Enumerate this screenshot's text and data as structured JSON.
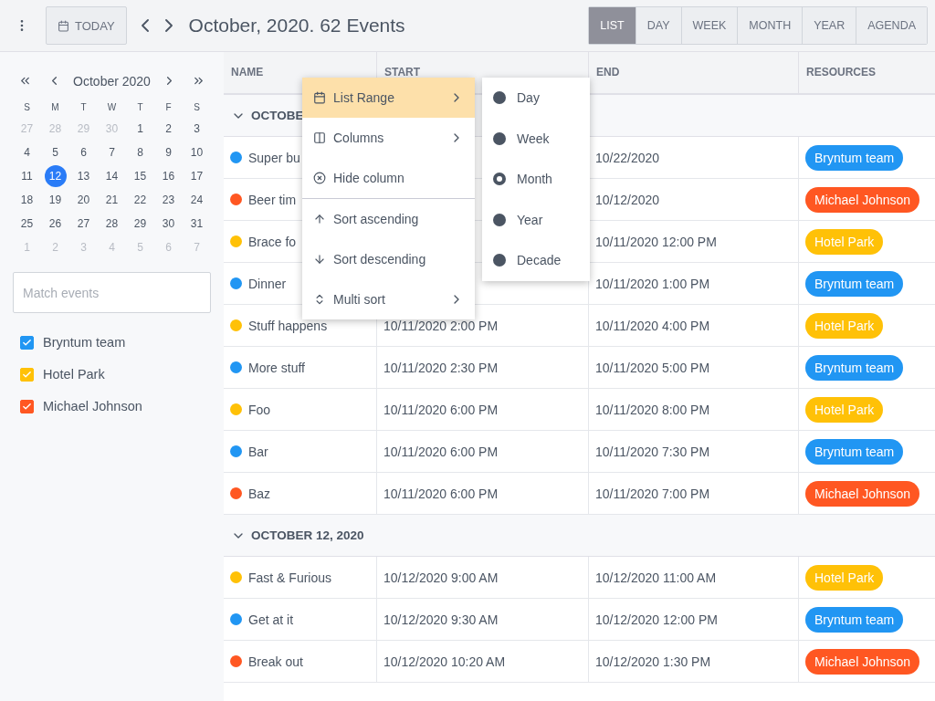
{
  "toolbar": {
    "today_button": "TODAY",
    "title": "October, 2020. 62 Events",
    "views": [
      {
        "label": "LIST",
        "selected": true
      },
      {
        "label": "DAY",
        "selected": false
      },
      {
        "label": "WEEK",
        "selected": false
      },
      {
        "label": "MONTH",
        "selected": false
      },
      {
        "label": "YEAR",
        "selected": false
      },
      {
        "label": "AGENDA",
        "selected": false
      }
    ]
  },
  "sidebar": {
    "calendar": {
      "title": "October 2020",
      "weekdays": [
        "S",
        "M",
        "T",
        "W",
        "T",
        "F",
        "S"
      ],
      "weeks": [
        [
          {
            "day": "27",
            "other_month": true,
            "selected": false
          },
          {
            "day": "28",
            "other_month": true,
            "selected": false
          },
          {
            "day": "29",
            "other_month": true,
            "selected": false
          },
          {
            "day": "30",
            "other_month": true,
            "selected": false
          },
          {
            "day": "1",
            "other_month": false,
            "selected": false
          },
          {
            "day": "2",
            "other_month": false,
            "selected": false
          },
          {
            "day": "3",
            "other_month": false,
            "selected": false
          }
        ],
        [
          {
            "day": "4",
            "other_month": false,
            "selected": false
          },
          {
            "day": "5",
            "other_month": false,
            "selected": false
          },
          {
            "day": "6",
            "other_month": false,
            "selected": false
          },
          {
            "day": "7",
            "other_month": false,
            "selected": false
          },
          {
            "day": "8",
            "other_month": false,
            "selected": false
          },
          {
            "day": "9",
            "other_month": false,
            "selected": false
          },
          {
            "day": "10",
            "other_month": false,
            "selected": false
          }
        ],
        [
          {
            "day": "11",
            "other_month": false,
            "selected": false
          },
          {
            "day": "12",
            "other_month": false,
            "selected": true
          },
          {
            "day": "13",
            "other_month": false,
            "selected": false
          },
          {
            "day": "14",
            "other_month": false,
            "selected": false
          },
          {
            "day": "15",
            "other_month": false,
            "selected": false
          },
          {
            "day": "16",
            "other_month": false,
            "selected": false
          },
          {
            "day": "17",
            "other_month": false,
            "selected": false
          }
        ],
        [
          {
            "day": "18",
            "other_month": false,
            "selected": false
          },
          {
            "day": "19",
            "other_month": false,
            "selected": false
          },
          {
            "day": "20",
            "other_month": false,
            "selected": false
          },
          {
            "day": "21",
            "other_month": false,
            "selected": false
          },
          {
            "day": "22",
            "other_month": false,
            "selected": false
          },
          {
            "day": "23",
            "other_month": false,
            "selected": false
          },
          {
            "day": "24",
            "other_month": false,
            "selected": false
          }
        ],
        [
          {
            "day": "25",
            "other_month": false,
            "selected": false
          },
          {
            "day": "26",
            "other_month": false,
            "selected": false
          },
          {
            "day": "27",
            "other_month": false,
            "selected": false
          },
          {
            "day": "28",
            "other_month": false,
            "selected": false
          },
          {
            "day": "29",
            "other_month": false,
            "selected": false
          },
          {
            "day": "30",
            "other_month": false,
            "selected": false
          },
          {
            "day": "31",
            "other_month": false,
            "selected": false
          }
        ],
        [
          {
            "day": "1",
            "other_month": true,
            "selected": false
          },
          {
            "day": "2",
            "other_month": true,
            "selected": false
          },
          {
            "day": "3",
            "other_month": true,
            "selected": false
          },
          {
            "day": "4",
            "other_month": true,
            "selected": false
          },
          {
            "day": "5",
            "other_month": true,
            "selected": false
          },
          {
            "day": "6",
            "other_month": true,
            "selected": false
          },
          {
            "day": "7",
            "other_month": true,
            "selected": false
          }
        ]
      ]
    },
    "filter": {
      "placeholder": "Match events"
    },
    "resources": [
      {
        "label": "Bryntum team",
        "checked": true,
        "color": "#2196f3"
      },
      {
        "label": "Hotel Park",
        "checked": true,
        "color": "#ffc107"
      },
      {
        "label": "Michael Johnson",
        "checked": true,
        "color": "#ff5722"
      }
    ]
  },
  "table": {
    "columns": [
      "NAME",
      "START",
      "END",
      "RESOURCES"
    ],
    "groups": [
      {
        "label": "OCTOBE",
        "expanded": true,
        "rows": [
          {
            "name": "Super bu",
            "end": "10/22/2020",
            "resource": "Bryntum team",
            "color": "#2196f3"
          },
          {
            "name": "Beer tim",
            "end": "10/12/2020",
            "resource": "Michael Johnson",
            "color": "#ff5722"
          },
          {
            "name": "Brace fo",
            "end": "10/11/2020 12:00 PM",
            "resource": "Hotel Park",
            "color": "#ffc107"
          },
          {
            "name": "Dinner",
            "end": "10/11/2020 1:00 PM",
            "resource": "Bryntum team",
            "color": "#2196f3"
          },
          {
            "name": "Stuff happens",
            "start": "10/11/2020 2:00 PM",
            "end": "10/11/2020 4:00 PM",
            "resource": "Hotel Park",
            "color": "#ffc107"
          },
          {
            "name": "More stuff",
            "start": "10/11/2020 2:30 PM",
            "end": "10/11/2020 5:00 PM",
            "resource": "Bryntum team",
            "color": "#2196f3"
          },
          {
            "name": "Foo",
            "start": "10/11/2020 6:00 PM",
            "end": "10/11/2020 8:00 PM",
            "resource": "Hotel Park",
            "color": "#ffc107"
          },
          {
            "name": "Bar",
            "start": "10/11/2020 6:00 PM",
            "end": "10/11/2020 7:30 PM",
            "resource": "Bryntum team",
            "color": "#2196f3"
          },
          {
            "name": "Baz",
            "start": "10/11/2020 6:00 PM",
            "end": "10/11/2020 7:00 PM",
            "resource": "Michael Johnson",
            "color": "#ff5722"
          }
        ]
      },
      {
        "label": "OCTOBER 12, 2020",
        "expanded": true,
        "rows": [
          {
            "name": "Fast & Furious",
            "start": "10/12/2020 9:00 AM",
            "end": "10/12/2020 11:00 AM",
            "resource": "Hotel Park",
            "color": "#ffc107"
          },
          {
            "name": "Get at it",
            "start": "10/12/2020 9:30 AM",
            "end": "10/12/2020 12:00 PM",
            "resource": "Bryntum team",
            "color": "#2196f3"
          },
          {
            "name": "Break out",
            "start": "10/12/2020 10:20 AM",
            "end": "10/12/2020 1:30 PM",
            "resource": "Michael Johnson",
            "color": "#ff5722"
          }
        ]
      }
    ]
  },
  "context_menu": {
    "sections": [
      [
        {
          "label": "List Range",
          "has_submenu": true,
          "selected": true
        },
        {
          "label": "Columns",
          "has_submenu": true,
          "selected": false
        },
        {
          "label": "Hide column",
          "has_submenu": false,
          "selected": false
        }
      ],
      [
        {
          "label": "Sort ascending",
          "has_submenu": false,
          "selected": false
        },
        {
          "label": "Sort descending",
          "has_submenu": false,
          "selected": false
        },
        {
          "label": "Multi sort",
          "has_submenu": true,
          "selected": false
        }
      ]
    ],
    "submenu": [
      {
        "label": "Day",
        "selected": false
      },
      {
        "label": "Week",
        "selected": false
      },
      {
        "label": "Month",
        "selected": true
      },
      {
        "label": "Year",
        "selected": false
      },
      {
        "label": "Decade",
        "selected": false
      }
    ]
  }
}
